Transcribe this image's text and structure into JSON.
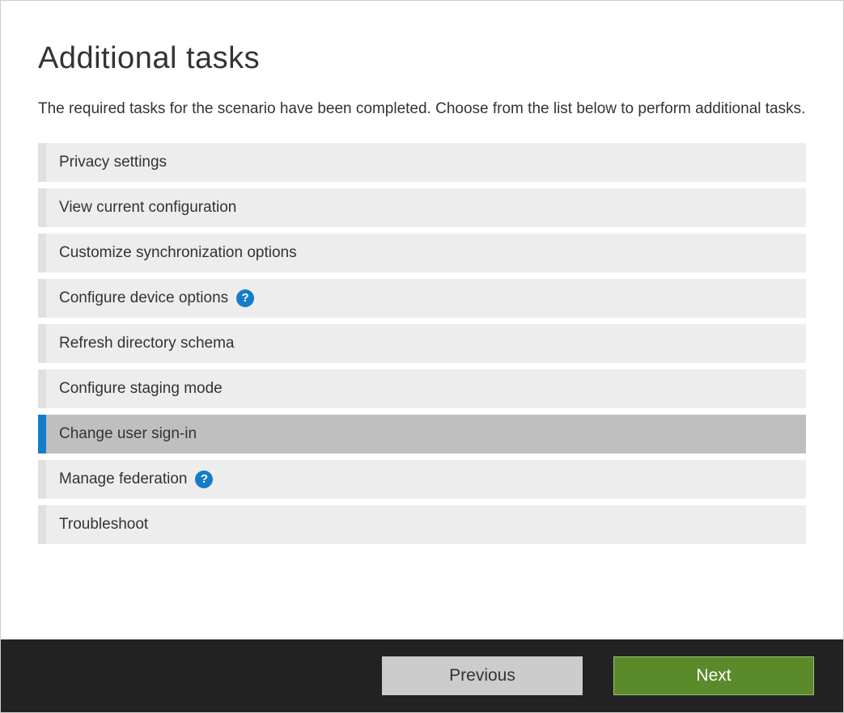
{
  "page": {
    "title": "Additional tasks",
    "description": "The required tasks for the scenario have been completed. Choose from the list below to perform additional tasks."
  },
  "tasks": [
    {
      "label": "Privacy settings",
      "selected": false,
      "hasHelp": false
    },
    {
      "label": "View current configuration",
      "selected": false,
      "hasHelp": false
    },
    {
      "label": "Customize synchronization options",
      "selected": false,
      "hasHelp": false
    },
    {
      "label": "Configure device options",
      "selected": false,
      "hasHelp": true
    },
    {
      "label": "Refresh directory schema",
      "selected": false,
      "hasHelp": false
    },
    {
      "label": "Configure staging mode",
      "selected": false,
      "hasHelp": false
    },
    {
      "label": "Change user sign-in",
      "selected": true,
      "hasHelp": false
    },
    {
      "label": "Manage federation",
      "selected": false,
      "hasHelp": true
    },
    {
      "label": "Troubleshoot",
      "selected": false,
      "hasHelp": false
    }
  ],
  "footer": {
    "previous_label": "Previous",
    "next_label": "Next"
  },
  "colors": {
    "accent": "#157dc8",
    "next_button": "#5a8a2a",
    "footer_bg": "#222222",
    "task_bg": "#ededed",
    "task_selected_bg": "#bfbfbf"
  }
}
